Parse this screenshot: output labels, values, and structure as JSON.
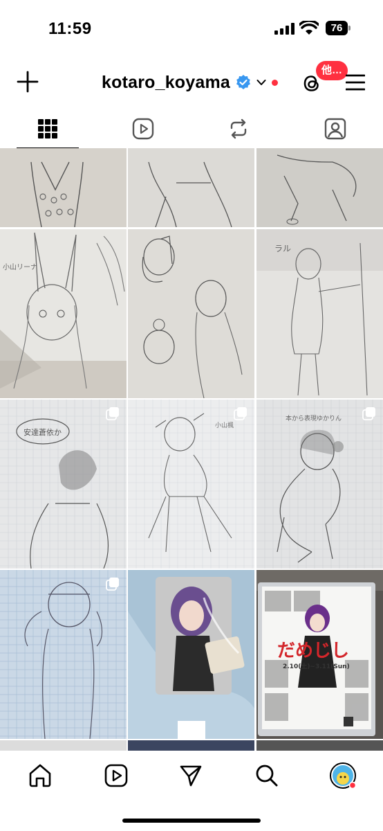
{
  "status_bar": {
    "time": "11:59",
    "battery": "76"
  },
  "header": {
    "username": "kotaro_koyama",
    "threads_badge": "他…",
    "verified_color": "#3897f0",
    "notify_color": "#ff3040"
  },
  "tabs": [
    {
      "icon": "grid-icon",
      "selected": true
    },
    {
      "icon": "reels-icon",
      "selected": false
    },
    {
      "icon": "reposts-icon",
      "selected": false
    },
    {
      "icon": "tagged-icon",
      "selected": false
    }
  ],
  "grid": {
    "posts": [
      {
        "label": "sketch-flowers-shirt",
        "multi": false
      },
      {
        "label": "sketch-girl-legs",
        "multi": false
      },
      {
        "label": "sketch-sitting-figure",
        "multi": false
      },
      {
        "label": "sketch-bunny-ears-girl",
        "text": "小山リーナ",
        "multi": false
      },
      {
        "label": "sketch-ponytail-girls",
        "multi": false
      },
      {
        "label": "sketch-violin-girl",
        "text": "ラル",
        "multi": false
      },
      {
        "label": "sketch-bob-hair-girl",
        "text": "安達蒼依か",
        "multi": true
      },
      {
        "label": "sketch-dancing-girl",
        "text": "小山楓",
        "multi": true
      },
      {
        "label": "sketch-crouching-girl",
        "text": "本から表現ゆかりん",
        "multi": true
      },
      {
        "label": "sketch-headphone-girl",
        "multi": true
      },
      {
        "label": "photo-merch-goods",
        "multi": false
      },
      {
        "label": "photo-event-poster",
        "text": "だめじし",
        "sub": "2.10(土)~3.11(Sun)",
        "multi": false
      }
    ]
  },
  "bottom_nav": [
    {
      "icon": "home-icon"
    },
    {
      "icon": "reels-icon"
    },
    {
      "icon": "send-icon"
    },
    {
      "icon": "search-icon"
    },
    {
      "icon": "profile-avatar"
    }
  ]
}
